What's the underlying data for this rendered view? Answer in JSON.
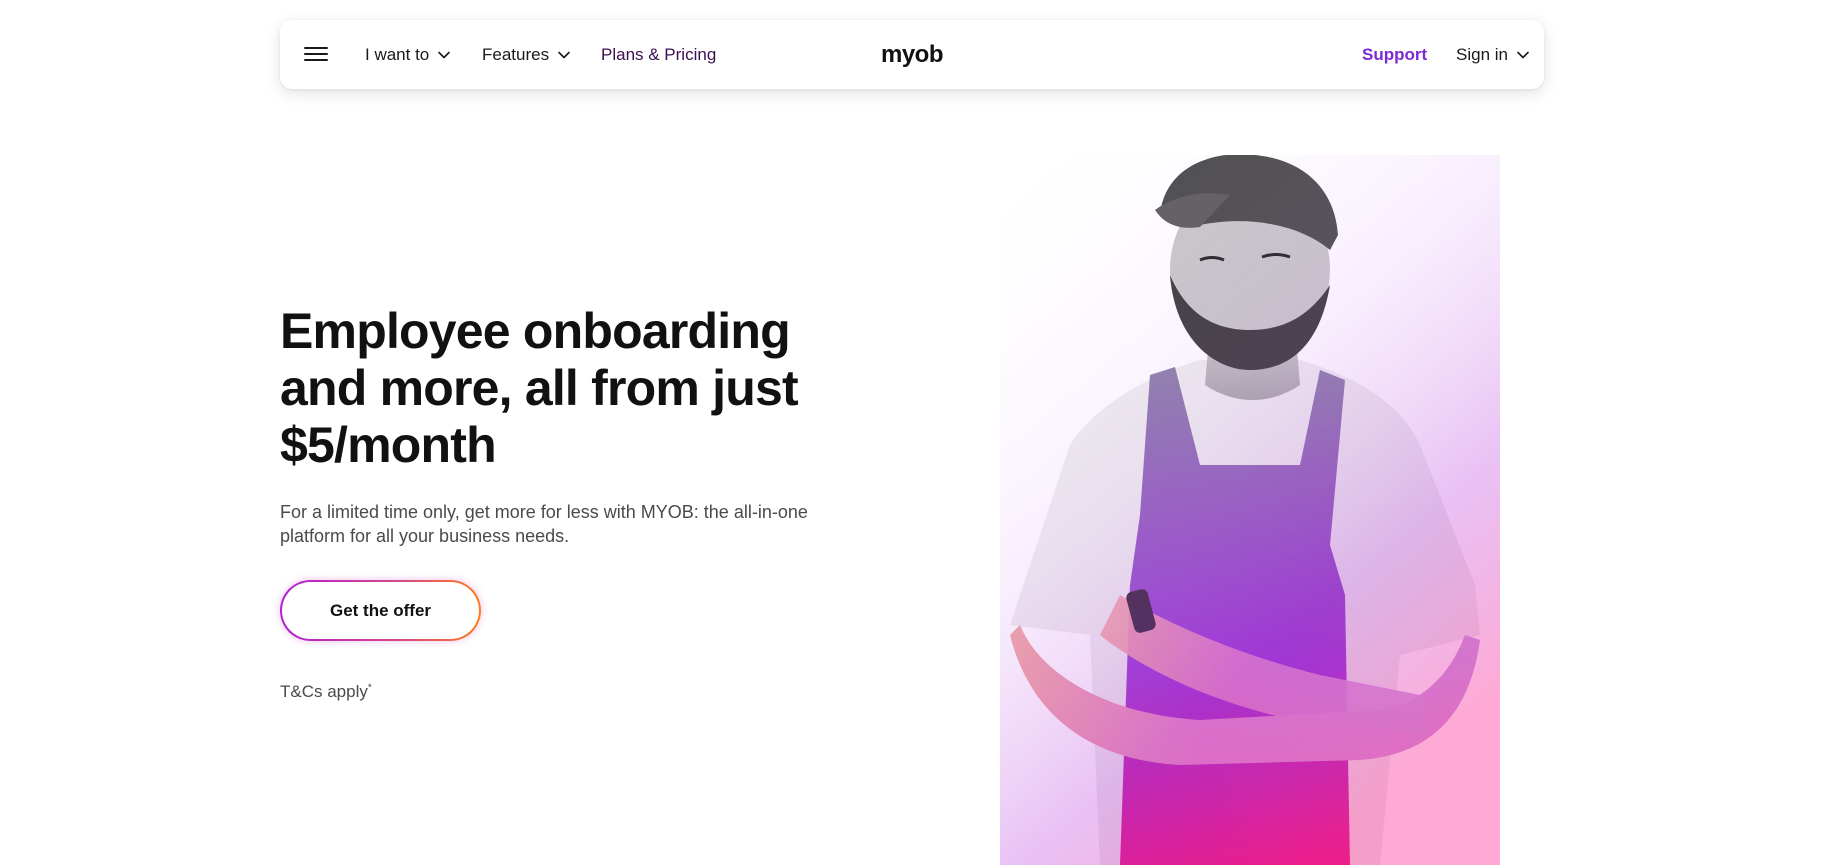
{
  "nav": {
    "menu_icon": "hamburger-icon",
    "items": [
      {
        "label": "I want to",
        "has_dropdown": true
      },
      {
        "label": "Features",
        "has_dropdown": true
      },
      {
        "label": "Plans & Pricing",
        "has_dropdown": false
      }
    ],
    "logo": "myob",
    "support": "Support",
    "signin": "Sign in"
  },
  "hero": {
    "title": "Employee onboarding and more, all from just $5/month",
    "description": "For a limited time only, get more for less with MYOB: the all-in-one platform for all your business needs.",
    "cta": "Get the offer",
    "terms": "T&Cs apply",
    "terms_mark": "*"
  },
  "colors": {
    "accent_purple": "#7b2ad3",
    "gradient_start": "#b01ed6",
    "gradient_end": "#ff7b1a",
    "pricing_text": "#3b0f4f"
  }
}
